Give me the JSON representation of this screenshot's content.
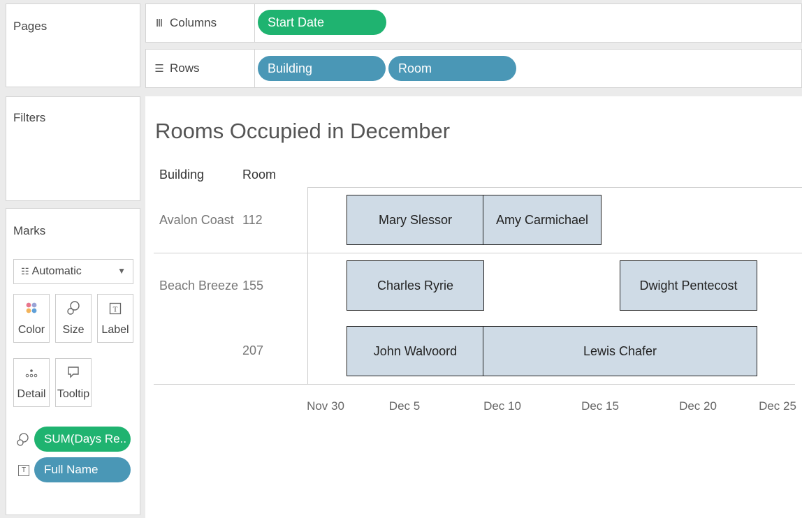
{
  "cards": {
    "pages_title": "Pages",
    "filters_title": "Filters"
  },
  "marks": {
    "title": "Marks",
    "mark_type": "Automatic",
    "buttons": {
      "color": "Color",
      "size": "Size",
      "label": "Label",
      "detail": "Detail",
      "tooltip": "Tooltip"
    },
    "pills": [
      {
        "label": "SUM(Days Re..",
        "icon": "size-icon",
        "color": "#1fb370"
      },
      {
        "label": "Full Name",
        "icon": "label-icon",
        "color": "#4a97b6"
      }
    ]
  },
  "shelves": {
    "columns_label": "Columns",
    "rows_label": "Rows",
    "columns_pills": [
      "Start Date"
    ],
    "rows_pills": [
      "Building",
      "Room"
    ]
  },
  "view": {
    "title": "Rooms Occupied in December",
    "header_building": "Building",
    "header_room": "Room"
  },
  "chart_data": {
    "type": "bar",
    "title": "Rooms Occupied in December",
    "x_ticks": [
      "Nov 30",
      "Dec 5",
      "Dec 10",
      "Dec 15",
      "Dec 20",
      "Dec 25"
    ],
    "rows": [
      {
        "building": "Avalon Coast",
        "room": "112",
        "bars": [
          {
            "name": "Mary Slessor",
            "start": "Dec 2",
            "end": "Dec 9"
          },
          {
            "name": "Amy Carmichael",
            "start": "Dec 9",
            "end": "Dec 15"
          }
        ]
      },
      {
        "building": "Beach Breeze",
        "room": "155",
        "bars": [
          {
            "name": "Charles Ryrie",
            "start": "Dec 2",
            "end": "Dec 9"
          },
          {
            "name": "Dwight Pentecost",
            "start": "Dec 16",
            "end": "Dec 23"
          }
        ]
      },
      {
        "building": "",
        "room": "207",
        "bars": [
          {
            "name": "John Walvoord",
            "start": "Dec 2",
            "end": "Dec 9"
          },
          {
            "name": "Lewis Chafer",
            "start": "Dec 9",
            "end": "Dec 23"
          }
        ]
      }
    ],
    "colors": {
      "bar_fill": "#cfdbe6",
      "bar_border": "#222222"
    }
  }
}
